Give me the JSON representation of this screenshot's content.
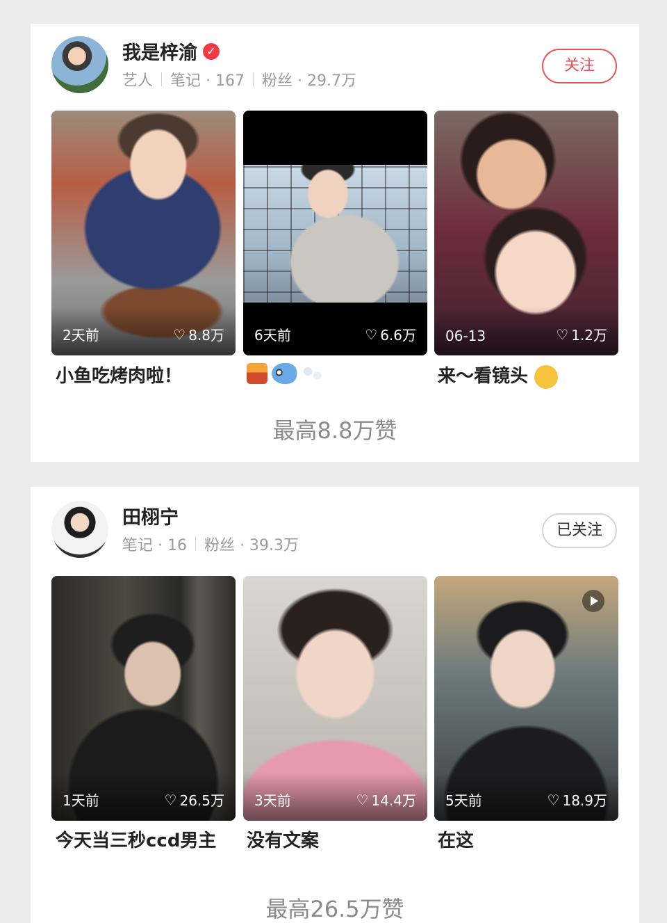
{
  "accounts": [
    {
      "name": "我是梓渝",
      "verified_icon": "verified-check-icon",
      "meta": {
        "role": "艺人",
        "notes": "笔记 · 167",
        "fans": "粉丝 · 29.7万"
      },
      "follow_label": "关注",
      "posts": [
        {
          "date": "2天前",
          "likes": "8.8万",
          "caption": "小鱼吃烤肉啦！"
        },
        {
          "date": "6天前",
          "likes": "6.6万",
          "caption": "",
          "caption_icons": [
            "city-sunset-icon",
            "fish-icon",
            "bubbles-icon"
          ]
        },
        {
          "date": "06-13",
          "likes": "1.2万",
          "caption": "来～看镜头",
          "caption_icon": "hugging-face-icon"
        }
      ],
      "max_likes": "最高8.8万赞"
    },
    {
      "name": "田栩宁",
      "meta": {
        "notes": "笔记 · 16",
        "fans": "粉丝 · 39.3万"
      },
      "follow_label": "已关注",
      "posts": [
        {
          "date": "1天前",
          "likes": "26.5万",
          "caption": "今天当三秒ccd男主"
        },
        {
          "date": "3天前",
          "likes": "14.4万",
          "caption": "没有文案"
        },
        {
          "date": "5天前",
          "likes": "18.9万",
          "caption": "在这",
          "video_icon": "play-icon"
        }
      ],
      "max_likes": "最高26.5万赞"
    }
  ],
  "colors": {
    "accent": "#e8515a",
    "meta_text": "#9b9b9b",
    "background": "#ececec"
  },
  "icons": {
    "heart": "♡"
  }
}
